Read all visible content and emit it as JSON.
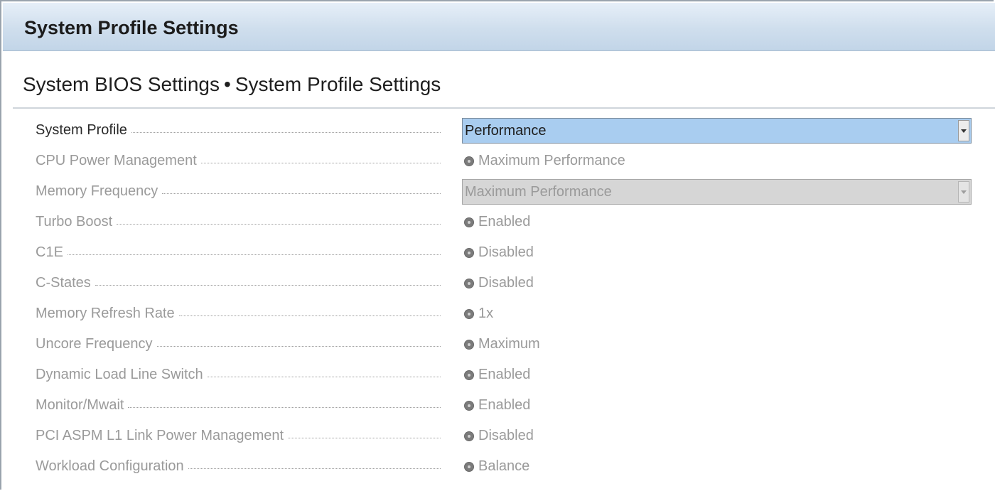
{
  "window": {
    "title": "System Profile Settings"
  },
  "breadcrumb": {
    "parent": "System BIOS Settings",
    "separator": "•",
    "current": "System Profile Settings"
  },
  "settings": [
    {
      "label": "System Profile",
      "control": "dropdown",
      "value": "Performance",
      "enabled": true
    },
    {
      "label": "CPU Power Management",
      "control": "radio",
      "value": "Maximum Performance",
      "enabled": false
    },
    {
      "label": "Memory Frequency",
      "control": "dropdown",
      "value": "Maximum Performance",
      "enabled": false
    },
    {
      "label": "Turbo Boost",
      "control": "radio",
      "value": "Enabled",
      "enabled": false
    },
    {
      "label": "C1E",
      "control": "radio",
      "value": "Disabled",
      "enabled": false
    },
    {
      "label": "C-States",
      "control": "radio",
      "value": "Disabled",
      "enabled": false
    },
    {
      "label": "Memory Refresh Rate",
      "control": "radio",
      "value": "1x",
      "enabled": false
    },
    {
      "label": "Uncore Frequency",
      "control": "radio",
      "value": "Maximum",
      "enabled": false
    },
    {
      "label": "Dynamic Load Line Switch",
      "control": "radio",
      "value": "Enabled",
      "enabled": false
    },
    {
      "label": "Monitor/Mwait",
      "control": "radio",
      "value": "Enabled",
      "enabled": false
    },
    {
      "label": "PCI ASPM L1 Link Power Management",
      "control": "radio",
      "value": "Disabled",
      "enabled": false
    },
    {
      "label": "Workload Configuration",
      "control": "radio",
      "value": "Balance",
      "enabled": false
    }
  ],
  "icons": {
    "dropdown": "chevron-down-icon",
    "radio": "radio-selected-icon"
  },
  "colors": {
    "title_bar": "#cfdeed",
    "active_dropdown": "#a9cdf0",
    "disabled_dropdown": "#d6d6d6",
    "disabled_text": "#9a9a9a",
    "active_text": "#2a2a2a"
  }
}
